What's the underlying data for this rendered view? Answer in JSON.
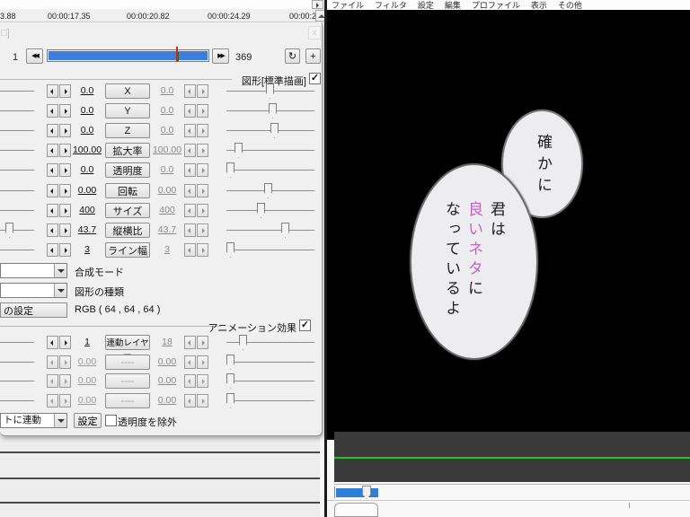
{
  "ruler": {
    "timestamps": [
      "3.88",
      "00:00:17.35",
      "00:00:20.82",
      "00:00:24.29",
      "00:00:2"
    ]
  },
  "menu": {
    "items": [
      "ファイル",
      "フィルタ",
      "設定",
      "編集",
      "プロファイル",
      "表示",
      "その他"
    ]
  },
  "icons": {
    "prev": "◀◀",
    "next": "▶▶",
    "refresh": "↻",
    "add": "+",
    "check": "✓",
    "close": "x"
  },
  "dialog": {
    "title_fragment": "□]",
    "frame": {
      "current": "1",
      "total": "369"
    },
    "section_shape": {
      "label": "図形[標準描画]",
      "checked": true
    },
    "params": [
      {
        "label": "X",
        "left": "0.0",
        "right": "0.0"
      },
      {
        "label": "Y",
        "left": "0.0",
        "right": "0.0"
      },
      {
        "label": "Z",
        "left": "0.0",
        "right": "0.0"
      },
      {
        "label": "拡大率",
        "left": "100.00",
        "right": "100.00"
      },
      {
        "label": "透明度",
        "left": "0.0",
        "right": "0.0"
      },
      {
        "label": "回転",
        "left": "0.00",
        "right": "0.00"
      },
      {
        "label": "サイズ",
        "left": "400",
        "right": "400"
      },
      {
        "label": "縦横比",
        "left": "43.7",
        "right": "43.7"
      },
      {
        "label": "ライン幅",
        "left": "3",
        "right": "3"
      }
    ],
    "composite_mode_label": "合成モード",
    "shape_type_label": "図形の種類",
    "color_button_fragment": "の設定",
    "rgb_text": "RGB ( 64 , 64 , 64 )",
    "section_anim": {
      "label": "アニメーション効果",
      "checked": true
    },
    "anim_params": [
      {
        "label": "連動レイヤー",
        "left": "1",
        "right": "18",
        "disabled": false
      },
      {
        "label": "----",
        "left": "0.00",
        "right": "0.00",
        "disabled": true
      },
      {
        "label": "----",
        "left": "0.00",
        "right": "0.00",
        "disabled": true
      },
      {
        "label": "----",
        "left": "0.00",
        "right": "0.00",
        "disabled": true
      }
    ],
    "anim_footer": {
      "dropdown_fragment": "トに連動",
      "settings_button": "設定",
      "exclude_label": "透明度を除外",
      "exclude_checked": false
    }
  },
  "preview": {
    "bubble_small_text": "確かに",
    "bubble_large": {
      "col1": "君は",
      "col2_pink": "良いネタ",
      "col2_rest": "に",
      "col3": "なっているよ"
    },
    "bubble_fill": "#edecee",
    "text_color": "#1c1c1c",
    "highlight_color": "#c263c6"
  },
  "colors": {
    "trackbar_blue": "#3c7de0",
    "playhead_red": "#d22619",
    "green_line": "#1dc81d",
    "seek_blue": "#2f7fd8",
    "strip_dark": "#3a3a3a"
  }
}
